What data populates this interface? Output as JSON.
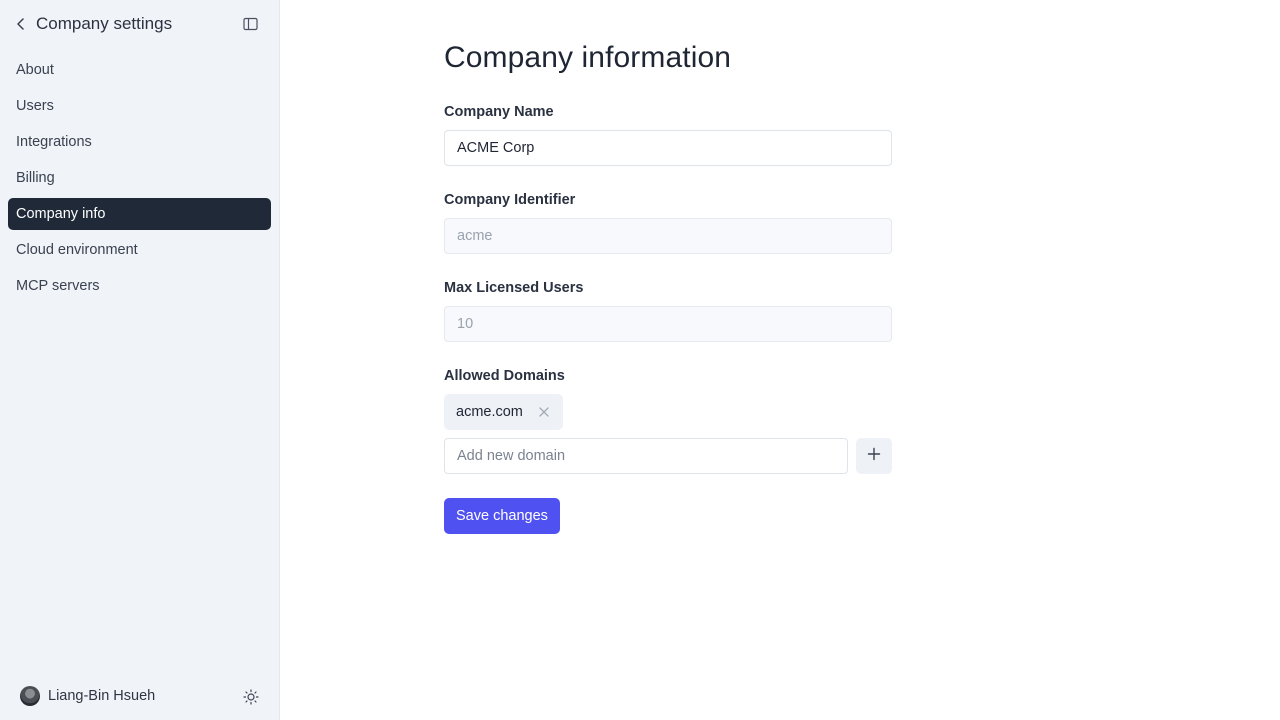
{
  "sidebar": {
    "title": "Company settings",
    "items": [
      {
        "label": "About"
      },
      {
        "label": "Users"
      },
      {
        "label": "Integrations"
      },
      {
        "label": "Billing"
      },
      {
        "label": "Company info",
        "active": true
      },
      {
        "label": "Cloud environment"
      },
      {
        "label": "MCP servers"
      }
    ],
    "user_name": "Liang-Bin Hsueh"
  },
  "main": {
    "title": "Company information",
    "company_name": {
      "label": "Company Name",
      "value": "ACME Corp"
    },
    "company_identifier": {
      "label": "Company Identifier",
      "value": "acme"
    },
    "max_users": {
      "label": "Max Licensed Users",
      "value": "10"
    },
    "allowed_domains": {
      "label": "Allowed Domains",
      "domains": [
        "acme.com"
      ],
      "add_placeholder": "Add new domain"
    },
    "save_label": "Save changes"
  },
  "colors": {
    "accent": "#4f52f0",
    "sidebar_bg": "#f0f3f8",
    "active_item_bg": "#1f2937"
  }
}
